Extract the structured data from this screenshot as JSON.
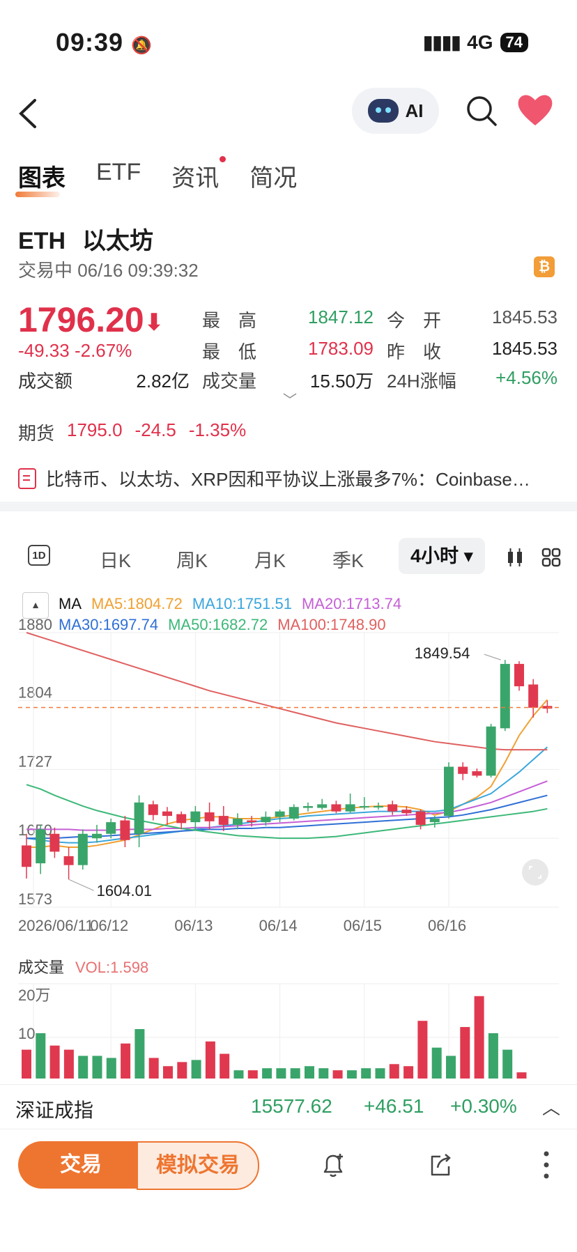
{
  "status_bar": {
    "time": "09:39",
    "network": "4G",
    "battery": "74"
  },
  "header": {
    "ai_label": "AI"
  },
  "tabs": [
    {
      "label": "图表",
      "active": true
    },
    {
      "label": "ETF"
    },
    {
      "label": "资讯",
      "badge": true
    },
    {
      "label": "简况"
    }
  ],
  "asset": {
    "symbol": "ETH",
    "name": "以太坊",
    "status_time": "交易中 06/16 09:39:32",
    "badge_icon": "bitcoin-icon",
    "badge_text": "₿",
    "price": "1796.20",
    "change": "-49.33",
    "change_pct": "-2.67%",
    "amount_label": "成交额",
    "amount_value": "2.82亿"
  },
  "stats": [
    {
      "label": "最　高",
      "value": "1847.12",
      "color": "#2f9e62"
    },
    {
      "label": "最　低",
      "value": "1783.09",
      "color": "#e0314b"
    },
    {
      "label": "成交量",
      "value": "15.50万",
      "color": "#222222"
    },
    {
      "label": "今　开",
      "value": "1845.53",
      "color": "#555555"
    },
    {
      "label": "昨　收",
      "value": "1845.53",
      "color": "#222222"
    },
    {
      "label": "24H涨幅",
      "value": "+4.56%",
      "color": "#2f9e62"
    }
  ],
  "futures": {
    "label": "期货",
    "price": "1795.0",
    "change": "-24.5",
    "change_pct": "-1.35%"
  },
  "news": {
    "text": "比特币、以太坊、XRP因和平协议上涨最多7%：Coinbase…"
  },
  "periods": {
    "items": [
      "1D",
      "日K",
      "周K",
      "月K",
      "季K"
    ],
    "active": "4小时"
  },
  "ma_legend": {
    "title": "MA",
    "items": [
      {
        "label": "MA5:1804.72",
        "color": "#f0a030"
      },
      {
        "label": "MA10:1751.51",
        "color": "#3aa6dc"
      },
      {
        "label": "MA20:1713.74",
        "color": "#c55fd6"
      },
      {
        "label": "MA30:1697.74",
        "color": "#2f6fd6"
      },
      {
        "label": "MA50:1682.72",
        "color": "#3cb878"
      },
      {
        "label": "MA100:1748.90",
        "color": "#e06060"
      }
    ]
  },
  "chart_data": {
    "type": "candlestick",
    "y_ticks": [
      "1880",
      "1804",
      "1727",
      "1650",
      "1573"
    ],
    "ylim": [
      1573,
      1880
    ],
    "x_ticks": [
      "2026/06/11",
      "06/12",
      "06/13",
      "06/14",
      "06/15",
      "06/16"
    ],
    "last_price": 1796.2,
    "high_label": "1849.54",
    "low_label": "1604.01",
    "candles": [
      {
        "o": 1642,
        "c": 1618,
        "h": 1655,
        "l": 1605
      },
      {
        "o": 1622,
        "c": 1660,
        "h": 1665,
        "l": 1610
      },
      {
        "o": 1655,
        "c": 1635,
        "h": 1662,
        "l": 1628
      },
      {
        "o": 1630,
        "c": 1620,
        "h": 1640,
        "l": 1604
      },
      {
        "o": 1620,
        "c": 1655,
        "h": 1660,
        "l": 1615
      },
      {
        "o": 1650,
        "c": 1655,
        "h": 1665,
        "l": 1645
      },
      {
        "o": 1655,
        "c": 1668,
        "h": 1672,
        "l": 1650
      },
      {
        "o": 1670,
        "c": 1648,
        "h": 1675,
        "l": 1640
      },
      {
        "o": 1655,
        "c": 1690,
        "h": 1698,
        "l": 1640
      },
      {
        "o": 1688,
        "c": 1676,
        "h": 1692,
        "l": 1670
      },
      {
        "o": 1680,
        "c": 1675,
        "h": 1685,
        "l": 1665
      },
      {
        "o": 1677,
        "c": 1667,
        "h": 1680,
        "l": 1660
      },
      {
        "o": 1668,
        "c": 1680,
        "h": 1686,
        "l": 1660
      },
      {
        "o": 1679,
        "c": 1669,
        "h": 1690,
        "l": 1660
      },
      {
        "o": 1675,
        "c": 1665,
        "h": 1686,
        "l": 1658
      },
      {
        "o": 1665,
        "c": 1672,
        "h": 1678,
        "l": 1660
      },
      {
        "o": 1670,
        "c": 1668,
        "h": 1675,
        "l": 1663
      },
      {
        "o": 1668,
        "c": 1674,
        "h": 1680,
        "l": 1664
      },
      {
        "o": 1674,
        "c": 1680,
        "h": 1682,
        "l": 1668
      },
      {
        "o": 1672,
        "c": 1685,
        "h": 1688,
        "l": 1670
      },
      {
        "o": 1684,
        "c": 1686,
        "h": 1690,
        "l": 1680
      },
      {
        "o": 1684,
        "c": 1688,
        "h": 1694,
        "l": 1682
      },
      {
        "o": 1688,
        "c": 1680,
        "h": 1692,
        "l": 1678
      },
      {
        "o": 1680,
        "c": 1688,
        "h": 1700,
        "l": 1678
      },
      {
        "o": 1686,
        "c": 1686,
        "h": 1696,
        "l": 1682
      },
      {
        "o": 1686,
        "c": 1686,
        "h": 1690,
        "l": 1682
      },
      {
        "o": 1688,
        "c": 1680,
        "h": 1692,
        "l": 1676
      },
      {
        "o": 1682,
        "c": 1678,
        "h": 1686,
        "l": 1675
      },
      {
        "o": 1680,
        "c": 1665,
        "h": 1682,
        "l": 1660
      },
      {
        "o": 1668,
        "c": 1672,
        "h": 1675,
        "l": 1662
      },
      {
        "o": 1675,
        "c": 1730,
        "h": 1735,
        "l": 1672
      },
      {
        "o": 1730,
        "c": 1722,
        "h": 1735,
        "l": 1715
      },
      {
        "o": 1725,
        "c": 1720,
        "h": 1728,
        "l": 1718
      },
      {
        "o": 1720,
        "c": 1775,
        "h": 1778,
        "l": 1718
      },
      {
        "o": 1773,
        "c": 1845,
        "h": 1849.54,
        "l": 1770
      },
      {
        "o": 1845,
        "c": 1820,
        "h": 1848,
        "l": 1815
      },
      {
        "o": 1822,
        "c": 1796,
        "h": 1828,
        "l": 1785
      },
      {
        "o": 1798,
        "c": 1795,
        "h": 1804,
        "l": 1790
      }
    ],
    "ma_series": [
      {
        "name": "MA5",
        "color": "#f0a030",
        "values": [
          1640,
          1640,
          1642,
          1640,
          1640,
          1642,
          1645,
          1648,
          1654,
          1660,
          1666,
          1670,
          1672,
          1674,
          1674,
          1672,
          1672,
          1672,
          1674,
          1676,
          1678,
          1680,
          1682,
          1684,
          1685,
          1686,
          1686,
          1685,
          1682,
          1676,
          1680,
          1688,
          1696,
          1708,
          1735,
          1765,
          1787,
          1805
        ]
      },
      {
        "name": "MA10",
        "color": "#3aa6dc",
        "values": [
          1650,
          1648,
          1646,
          1645,
          1645,
          1646,
          1648,
          1650,
          1652,
          1654,
          1656,
          1658,
          1660,
          1662,
          1664,
          1666,
          1668,
          1670,
          1672,
          1673,
          1675,
          1676,
          1677,
          1678,
          1679,
          1680,
          1680,
          1680,
          1680,
          1680,
          1682,
          1688,
          1694,
          1700,
          1712,
          1724,
          1738,
          1752
        ]
      },
      {
        "name": "MA20",
        "color": "#c55fd6",
        "values": [
          1660,
          1660,
          1660,
          1660,
          1659,
          1659,
          1659,
          1660,
          1660,
          1660,
          1661,
          1661,
          1662,
          1662,
          1663,
          1664,
          1665,
          1666,
          1667,
          1668,
          1669,
          1670,
          1671,
          1672,
          1673,
          1674,
          1675,
          1676,
          1677,
          1678,
          1679,
          1682,
          1686,
          1690,
          1696,
          1702,
          1708,
          1714
        ]
      },
      {
        "name": "MA30",
        "color": "#2f6fd6",
        "values": [
          1650,
          1650,
          1650,
          1651,
          1652,
          1652,
          1653,
          1654,
          1655,
          1656,
          1657,
          1658,
          1659,
          1660,
          1660,
          1661,
          1661,
          1662,
          1662,
          1663,
          1664,
          1665,
          1666,
          1667,
          1668,
          1669,
          1670,
          1671,
          1672,
          1673,
          1674,
          1676,
          1679,
          1682,
          1686,
          1690,
          1694,
          1698
        ]
      },
      {
        "name": "MA50",
        "color": "#3cb878",
        "values": [
          1710,
          1705,
          1698,
          1692,
          1686,
          1681,
          1677,
          1673,
          1670,
          1667,
          1664,
          1661,
          1659,
          1657,
          1655,
          1653,
          1652,
          1651,
          1650,
          1650,
          1650,
          1651,
          1652,
          1654,
          1656,
          1658,
          1660,
          1662,
          1664,
          1666,
          1668,
          1670,
          1672,
          1674,
          1676,
          1678,
          1680,
          1683
        ]
      },
      {
        "name": "MA100",
        "color": "#e06060",
        "values": [
          1880,
          1875,
          1870,
          1865,
          1860,
          1855,
          1850,
          1845,
          1840,
          1835,
          1830,
          1825,
          1820,
          1815,
          1811,
          1807,
          1803,
          1799,
          1795,
          1791,
          1787,
          1783,
          1779,
          1776,
          1773,
          1770,
          1767,
          1764,
          1761,
          1758,
          1756,
          1754,
          1752,
          1750,
          1749,
          1749,
          1749,
          1749
        ]
      }
    ],
    "volume": {
      "label": "成交量",
      "indicator": "VOL:1.598",
      "y_ticks": [
        "20万",
        "10"
      ],
      "ylim": [
        0,
        23
      ],
      "values": [
        7,
        11,
        8,
        7,
        5.5,
        5.5,
        5,
        8.5,
        12,
        5,
        3,
        4,
        4.5,
        9,
        6,
        2,
        2,
        2.5,
        2.5,
        2.5,
        3,
        2.5,
        2,
        2,
        2.5,
        2.5,
        3.5,
        3,
        14,
        7.5,
        5.5,
        12.5,
        20,
        11,
        7,
        1.5
      ]
    }
  },
  "ticker": {
    "name": "深证成指",
    "value": "15577.62",
    "change": "+46.51",
    "change_pct": "+0.30%"
  },
  "actions": {
    "trade": "交易",
    "simulate": "模拟交易"
  }
}
